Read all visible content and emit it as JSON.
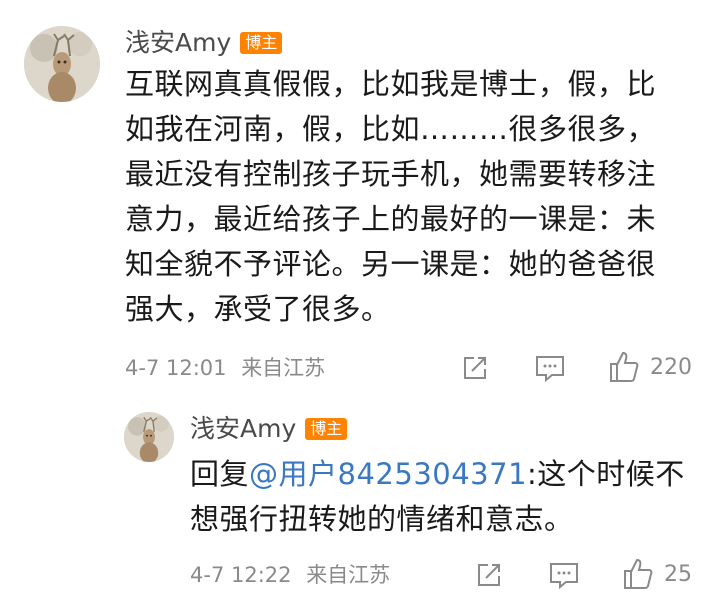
{
  "comment": {
    "author": "浅安Amy",
    "badge": "博主",
    "lines": [
      "互联网真真假假，比如我是博士，假，比",
      "如我在河南，假，比如………很多很多，",
      "最近没有控制孩子玩手机，她需要转移注",
      "意力，最近给孩子上的最好的一课是：未",
      "知全貌不予评论。另一课是：她的爸爸很",
      "强大，承受了很多。"
    ],
    "time": "4-7 12:01",
    "location": "来自江苏",
    "like_count": "220"
  },
  "reply": {
    "author": "浅安Amy",
    "badge": "博主",
    "prefix": "回复",
    "mention": "@用户8425304371",
    "line1_rest": ":这个时候不",
    "line2": "想强行扭转她的情绪和意志。",
    "time": "4-7 12:22",
    "location": "来自江苏",
    "like_count": "25"
  },
  "icons": {
    "share": "share-icon",
    "comment": "comment-icon",
    "like": "thumbs-up-icon"
  },
  "colors": {
    "badge": "#ff8200",
    "mention": "#3a78c2",
    "meta": "#8a8a8a"
  }
}
